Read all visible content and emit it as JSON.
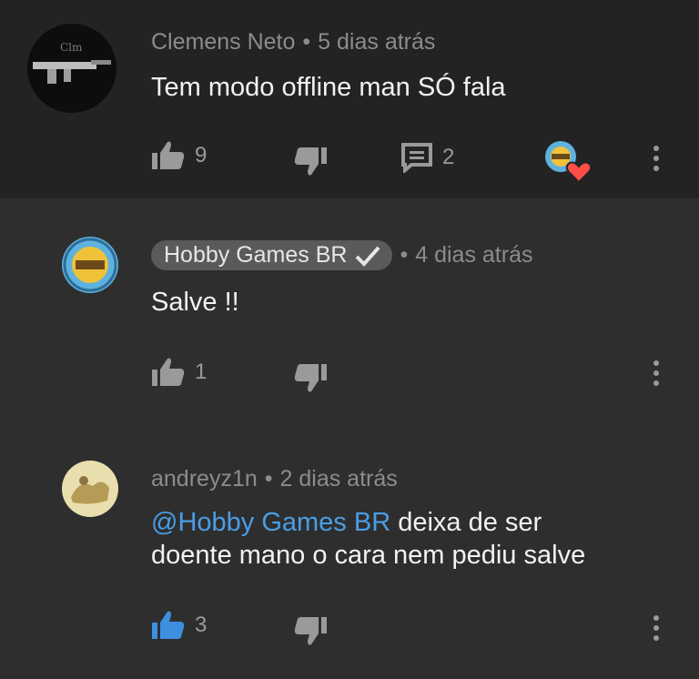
{
  "comments": [
    {
      "author": "Clemens Neto",
      "time": "5 dias atrás",
      "text": "Tem modo offline man SÓ fala",
      "likes": "9",
      "replies": "2"
    },
    {
      "author": "Hobby Games BR",
      "time": "4 dias atrás",
      "text": "Salve !!",
      "likes": "1"
    },
    {
      "author": "andreyz1n",
      "time": "2 dias atrás",
      "mention": "@Hobby Games BR",
      "text_line1": " deixa de ser",
      "text_line2": "doente mano o cara nem pediu salve",
      "likes": "3"
    }
  ],
  "icons": [
    "avatar-clemens",
    "thumb-up-icon",
    "thumb-down-icon",
    "reply-icon",
    "creator-heart-icon",
    "more-vert-icon",
    "verified-check-icon"
  ],
  "colors": {
    "background": "#2e2e2e",
    "top_background": "#232323",
    "mention": "#4a9ee6",
    "liked": "#3d8fe0",
    "heart": "#ff4e45"
  }
}
